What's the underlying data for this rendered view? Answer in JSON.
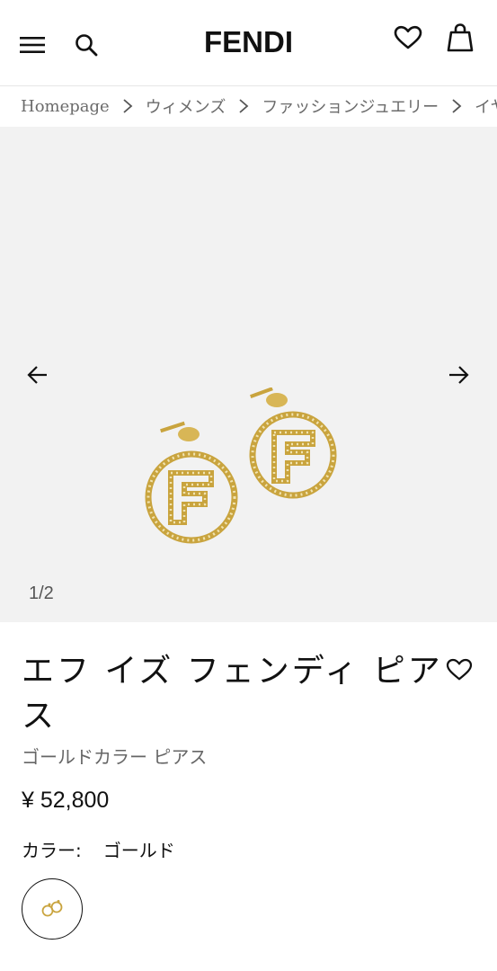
{
  "header": {
    "brand": "FENDI",
    "icons": {
      "menu": "hamburger-menu-icon",
      "search": "search-icon",
      "wishlist": "heart-icon",
      "bag": "shopping-bag-icon"
    }
  },
  "breadcrumb": {
    "items": [
      "Homepage",
      "ウィメンズ",
      "ファッションジュエリー",
      "イヤリ"
    ]
  },
  "gallery": {
    "counter": "1/2",
    "background": "#f2f2f2",
    "accent_gold": "#c9a43e"
  },
  "product": {
    "title": "エフ イズ フェンディ ピアス",
    "subtitle": "ゴールドカラー ピアス",
    "price": "¥ 52,800",
    "color_label": "カラー:",
    "color_value": "ゴールド"
  }
}
